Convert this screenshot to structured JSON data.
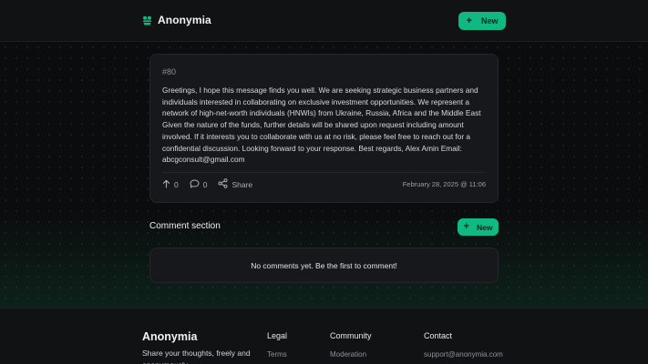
{
  "header": {
    "brand": "Anonymia",
    "new_label": "New",
    "accent": "#10b981"
  },
  "post": {
    "id": "#80",
    "body": "Greetings, I hope this message finds you well. We are seeking strategic business partners and individuals interested in collaborating on exclusive investment opportunities. We represent a network of high-net-worth individuals (HNWIs) from Ukraine, Russia, Africa and the Middle East Given the nature of the funds, further details will be shared upon request including amount involved. If it interests you to collaborate with us at no risk, please feel free to reach out for a confidential discussion. Looking forward to your response. Best regards, Alex Amin Email: abcgconsult@gmail.com",
    "upvotes": "0",
    "comments": "0",
    "share_label": "Share",
    "date": "February 28, 2025 @ 11:06"
  },
  "comments_section": {
    "title": "Comment section",
    "new_label": "New",
    "empty_text": "No comments yet. Be the first to comment!"
  },
  "footer": {
    "brand": "Anonymia",
    "tagline": "Share your thoughts, freely and anonymously.",
    "columns": [
      {
        "heading": "Legal",
        "link": "Terms"
      },
      {
        "heading": "Community",
        "link": "Moderation"
      },
      {
        "heading": "Contact",
        "link": "support@anonymia.com"
      }
    ]
  }
}
